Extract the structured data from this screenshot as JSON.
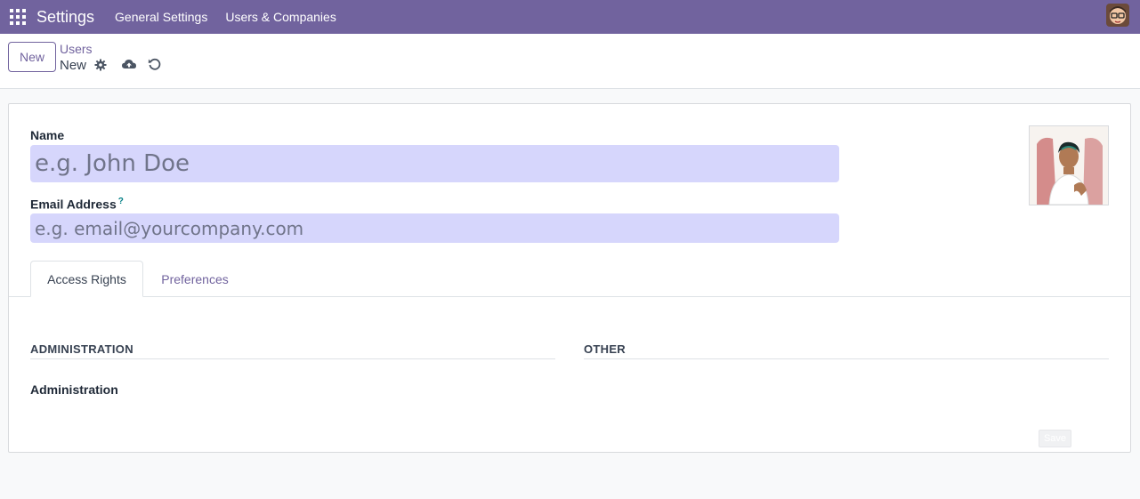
{
  "navbar": {
    "app_name": "Settings",
    "menu": [
      "General Settings",
      "Users & Companies"
    ]
  },
  "control_panel": {
    "new_label": "New",
    "breadcrumb": "Users",
    "record_name": "New"
  },
  "form": {
    "name_label": "Name",
    "name_placeholder": "e.g. John Doe",
    "email_label": "Email Address",
    "email_help": "?",
    "email_placeholder": "e.g. email@yourcompany.com"
  },
  "tabs": [
    {
      "label": "Access Rights",
      "active": true
    },
    {
      "label": "Preferences",
      "active": false
    }
  ],
  "access_rights": {
    "administration_title": "ADMINISTRATION",
    "other_title": "OTHER",
    "administration_field": "Administration"
  },
  "footer": {
    "save_label": "Save"
  },
  "colors": {
    "brand": "#71639e",
    "input_bg": "#d6d6fc"
  }
}
